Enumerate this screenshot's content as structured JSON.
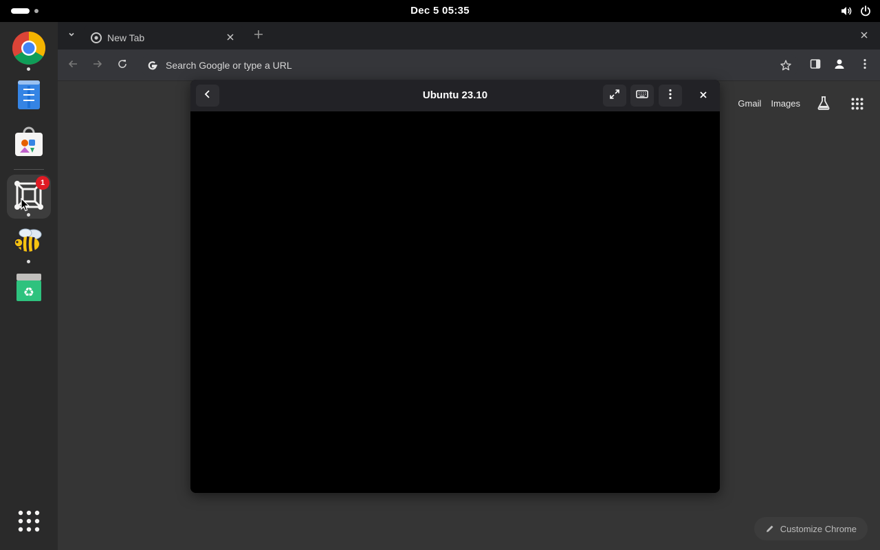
{
  "topbar": {
    "clock": "Dec 5  05:35",
    "icons": [
      "volume-icon",
      "power-icon"
    ]
  },
  "dock": {
    "apps": [
      {
        "name": "Google Chrome",
        "icon": "chrome-icon",
        "running": true
      },
      {
        "name": "Text Editor",
        "icon": "text-editor-icon",
        "running": false
      },
      {
        "name": "App Center",
        "icon": "app-center-icon",
        "running": false
      },
      {
        "name": "GNOME Boxes",
        "icon": "boxes-icon",
        "running": true,
        "active": true,
        "badge": "1"
      },
      {
        "name": "Bee",
        "icon": "bee-icon",
        "running": true
      },
      {
        "name": "Trash",
        "icon": "trash-icon",
        "running": false
      }
    ],
    "show_apps_icon": "show-apps-icon"
  },
  "browser": {
    "tab": {
      "title": "New Tab"
    },
    "omnibox": {
      "placeholder": "Search Google or type a URL"
    },
    "ntp": {
      "links": [
        "Gmail",
        "Images"
      ],
      "customize_label": "Customize Chrome"
    }
  },
  "dialog": {
    "title": "Ubuntu 23.10"
  },
  "colors": {
    "topbar": "#000000",
    "dock": "#2a2a2a",
    "browser_bg": "#353535",
    "badge": "#e01b24"
  }
}
